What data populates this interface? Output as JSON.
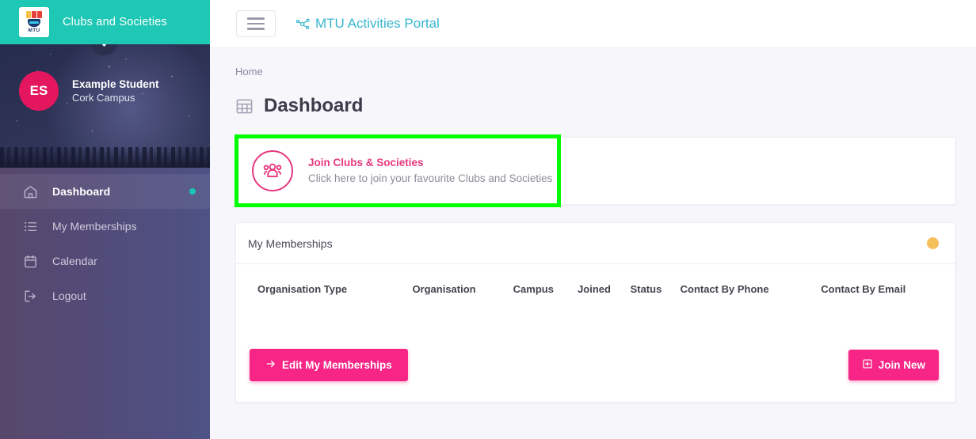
{
  "brand": {
    "logo_text": "MTU",
    "title": "Clubs and Societies",
    "logo_icon": "mtu-shield-logo",
    "collapse_icon": "chevron-down-icon"
  },
  "profile": {
    "initials": "ES",
    "name": "Example Student",
    "campus": "Cork Campus"
  },
  "sidebar": {
    "items": [
      {
        "label": "Dashboard",
        "icon": "home-icon",
        "active": true,
        "dot": true
      },
      {
        "label": "My Memberships",
        "icon": "list-icon",
        "active": false,
        "dot": false
      },
      {
        "label": "Calendar",
        "icon": "calendar-icon",
        "active": false,
        "dot": false
      },
      {
        "label": "Logout",
        "icon": "logout-icon",
        "active": false,
        "dot": false
      }
    ]
  },
  "topbar": {
    "menu_icon": "hamburger-menu-icon",
    "portal_icon": "network-nodes-icon",
    "portal_title": "MTU Activities Portal"
  },
  "page": {
    "breadcrumb": "Home",
    "title": "Dashboard",
    "title_icon": "grid-table-icon"
  },
  "join_card": {
    "icon": "users-group-icon",
    "title": "Join Clubs & Societies",
    "subtitle": "Click here to join your favourite Clubs and Societies",
    "highlight_color": "#00ff00"
  },
  "memberships": {
    "title": "My Memberships",
    "status_dot_color": "#f5c05a",
    "columns": [
      "Organisation Type",
      "Organisation",
      "Campus",
      "Joined",
      "Status",
      "Contact By Phone",
      "Contact By Email"
    ],
    "rows": [],
    "edit_button": "Edit My Memberships",
    "edit_button_icon": "arrow-right-icon",
    "join_button": "Join New",
    "join_button_icon": "plus-square-icon"
  },
  "colors": {
    "teal": "#1fc8b4",
    "pink": "#f72585",
    "pink_accent": "#e8397f",
    "portal_blue": "#38b7cf",
    "sidebar_start": "#58476b",
    "sidebar_end": "#4e5285",
    "active_dot": "#1bc5b4"
  }
}
